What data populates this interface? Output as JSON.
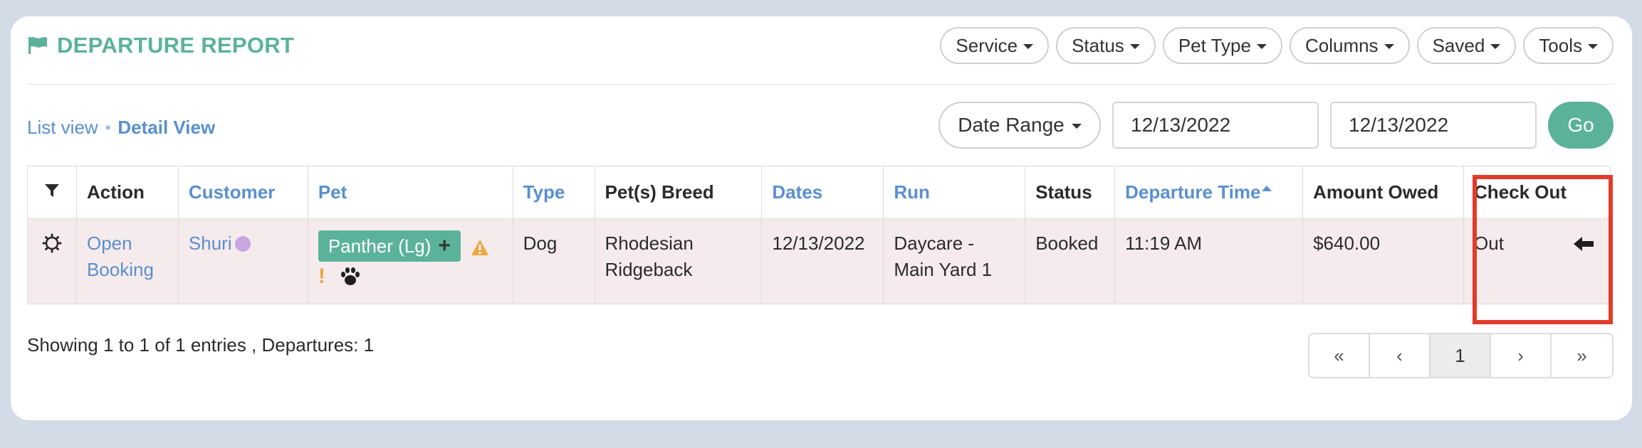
{
  "header": {
    "title": "DEPARTURE REPORT",
    "icon": "flag-icon",
    "buttons": [
      "Service",
      "Status",
      "Pet Type",
      "Columns",
      "Saved",
      "Tools"
    ]
  },
  "views": {
    "list": "List view",
    "separator": "•",
    "detail": "Detail View",
    "active": "Detail View"
  },
  "filters": {
    "date_range_label": "Date Range",
    "start_date": "12/13/2022",
    "end_date": "12/13/2022",
    "go_label": "Go"
  },
  "table": {
    "columns": [
      "Action",
      "Customer",
      "Pet",
      "Type",
      "Pet(s) Breed",
      "Dates",
      "Run",
      "Status",
      "Departure Time",
      "Amount Owed",
      "Check Out"
    ],
    "sorted_column": "Departure Time",
    "rows": [
      {
        "action_line1": "Open",
        "action_line2": "Booking",
        "customer": "Shuri",
        "customer_dot_color": "#c8a6e2",
        "pet": "Panther (Lg)",
        "type": "Dog",
        "breed_line1": "Rhodesian",
        "breed_line2": "Ridgeback",
        "dates": "12/13/2022",
        "run_line1": "Daycare -",
        "run_line2": "Main Yard 1",
        "status": "Booked",
        "departure_time": "11:19 AM",
        "amount_owed": "$640.00",
        "check_out": "Out"
      }
    ]
  },
  "footer": {
    "summary": "Showing 1 to 1 of 1 entries , Departures: 1",
    "pager": {
      "first": "«",
      "prev": "‹",
      "current": "1",
      "next": "›",
      "last": "»"
    }
  },
  "colors": {
    "accent": "#5bb29a",
    "link": "#5a8fd0",
    "row_bg": "#f6ebec",
    "highlight": "#e13b2b",
    "warning": "#f0a640"
  }
}
